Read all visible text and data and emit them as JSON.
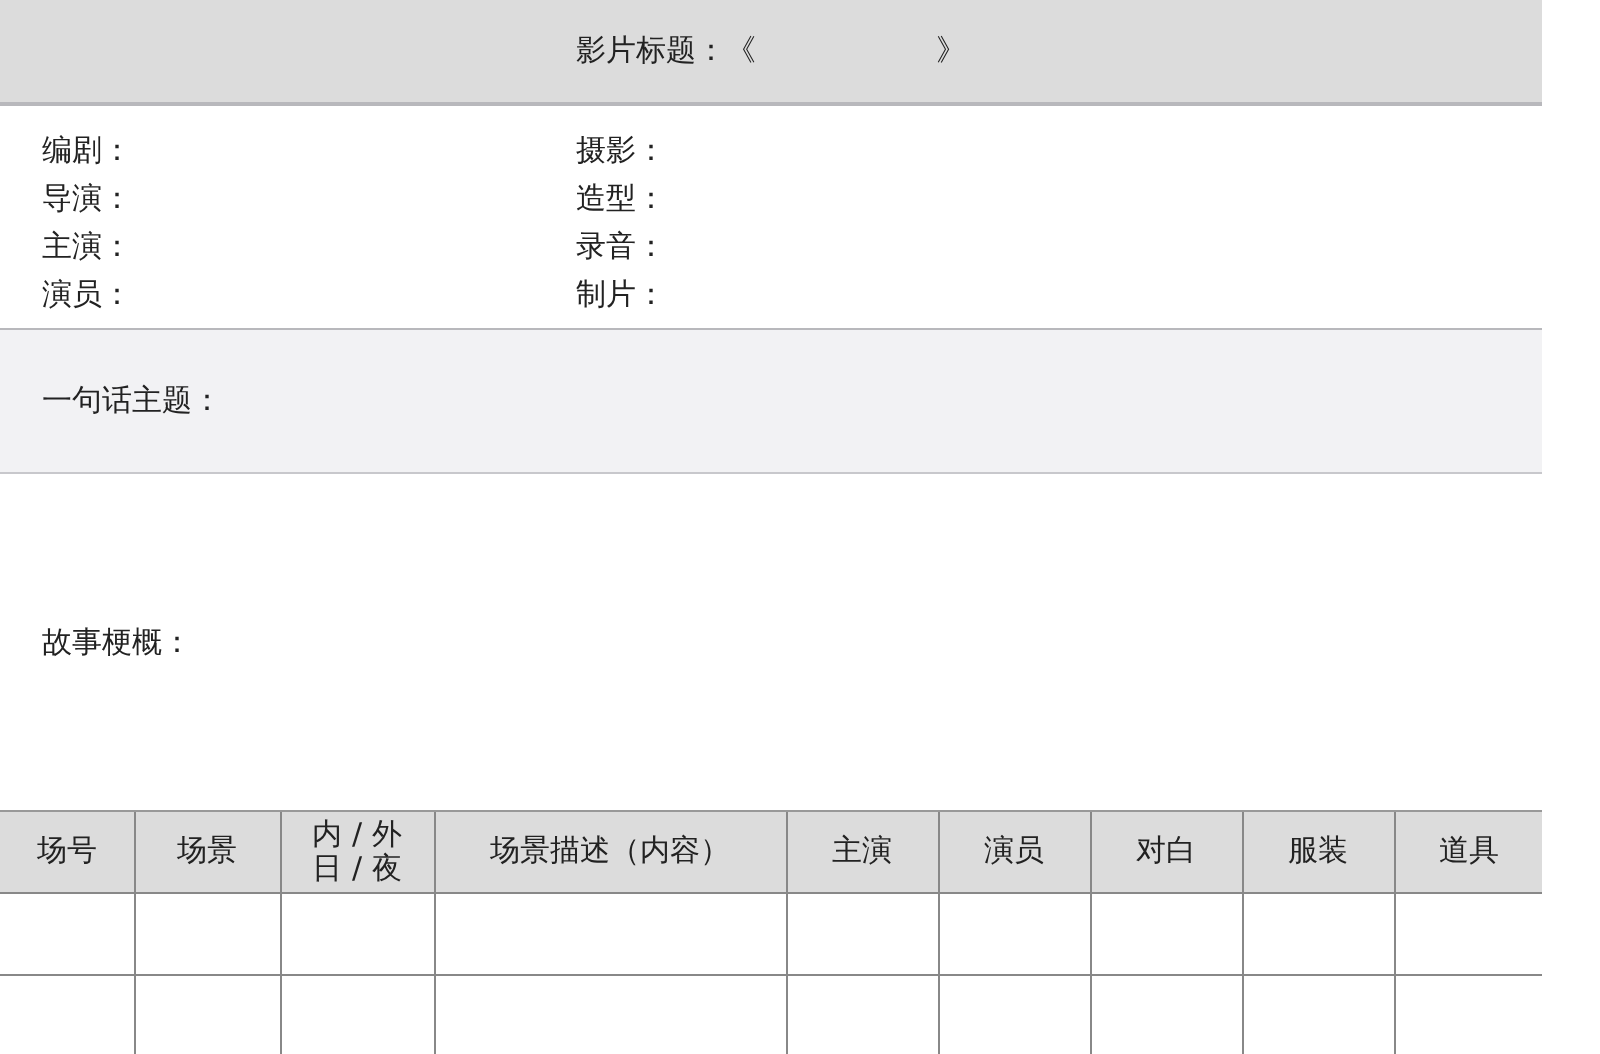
{
  "title_bar": {
    "label": "影片标题：《",
    "closing": "》"
  },
  "credits": {
    "left": [
      "编剧：",
      "导演：",
      "主演：",
      "演员："
    ],
    "right": [
      "摄影：",
      "造型：",
      "录音：",
      "制片："
    ]
  },
  "theme": {
    "label": "一句话主题："
  },
  "synopsis": {
    "label": "故事梗概："
  },
  "table": {
    "columns": [
      {
        "label": "场号"
      },
      {
        "label": "场景"
      },
      {
        "lines": [
          "内 / 外",
          "日 / 夜"
        ]
      },
      {
        "label": "场景描述（内容）"
      },
      {
        "label": "主演"
      },
      {
        "label": "演员"
      },
      {
        "label": "对白"
      },
      {
        "label": "服装"
      },
      {
        "label": "道具"
      }
    ]
  }
}
